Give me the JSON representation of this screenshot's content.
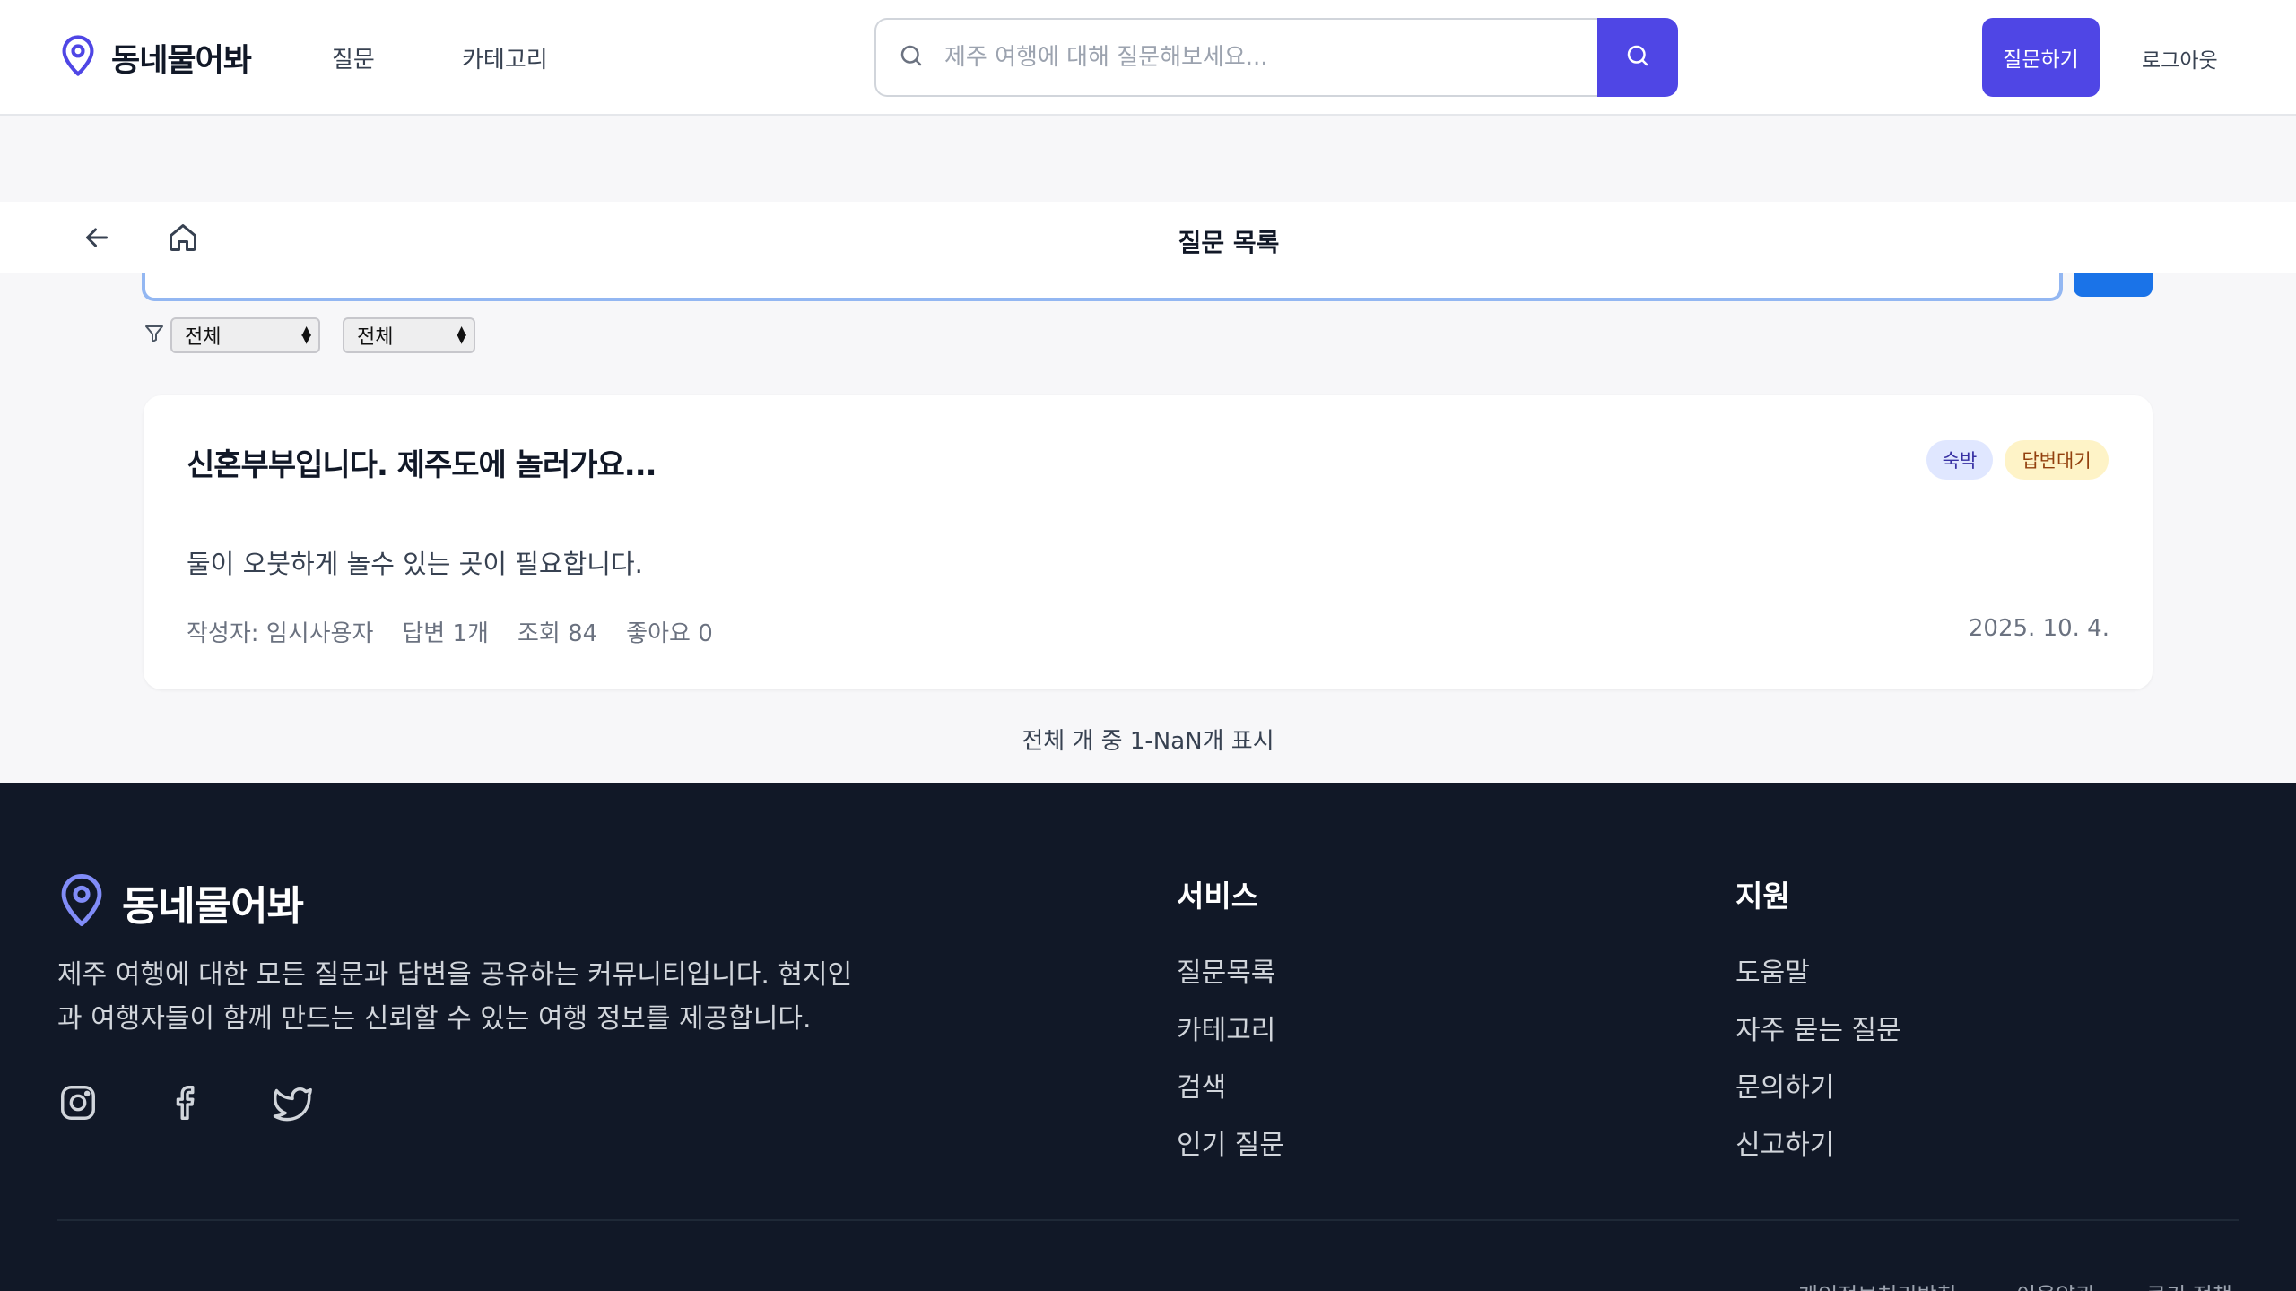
{
  "app": {
    "name": "동네물어봐"
  },
  "nav": {
    "questions": "질문",
    "categories": "카테고리"
  },
  "search": {
    "placeholder": "제주 여행에 대해 질문해보세요..."
  },
  "header": {
    "ask_button": "질문하기",
    "logout": "로그아웃"
  },
  "subbar": {
    "title": "질문 목록"
  },
  "filters": {
    "category": "전체",
    "status": "전체"
  },
  "question": {
    "title": "신혼부부입니다. 제주도에 놀러가요...",
    "category_badge": "숙박",
    "status_badge": "답변대기",
    "body": "둘이 오붓하게 놀수 있는 곳이 필요합니다.",
    "author": "작성자: 임시사용자",
    "answers": "답변 1개",
    "views": "조회 84",
    "likes": "좋아요 0",
    "date": "2025. 10. 4."
  },
  "pagination": {
    "info": "전체 개 중 1-NaN개 표시"
  },
  "footer": {
    "brand": "동네물어봐",
    "description": "제주 여행에 대한 모든 질문과 답변을 공유하는 커뮤니티입니다. 현지인과 여행자들이 함께 만드는 신뢰할 수 있는 여행 정보를 제공합니다.",
    "social": [
      "instagram-icon",
      "facebook-icon",
      "twitter-icon"
    ],
    "services": {
      "title": "서비스",
      "links": [
        "질문목록",
        "카테고리",
        "검색",
        "인기 질문"
      ]
    },
    "support": {
      "title": "지원",
      "links": [
        "도움말",
        "자주 묻는 질문",
        "문의하기",
        "신고하기"
      ]
    },
    "bottom_links": [
      "개인정보처리방침",
      "이용약관",
      "쿠키 정책"
    ]
  },
  "colors": {
    "primary": "#4f46e5",
    "footer_bg": "#111827"
  }
}
